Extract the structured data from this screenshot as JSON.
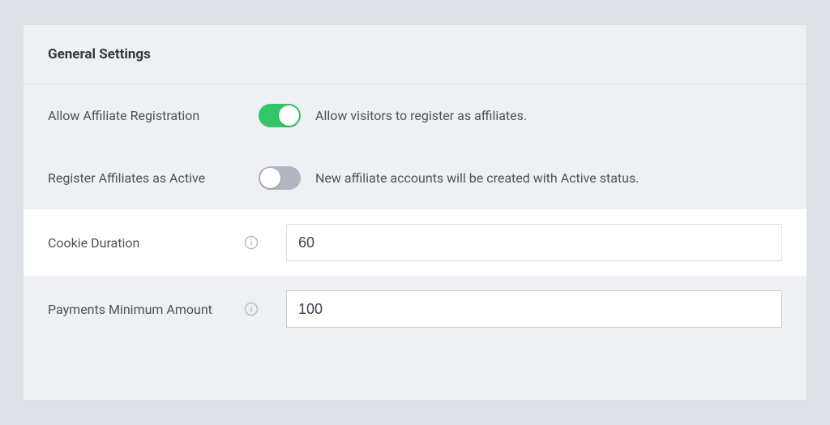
{
  "header": {
    "title": "General Settings"
  },
  "settings": {
    "allowRegistration": {
      "label": "Allow Affiliate Registration",
      "description": "Allow visitors to register as affiliates.",
      "enabled": true
    },
    "registerAsActive": {
      "label": "Register Affiliates as Active",
      "description": "New affiliate accounts will be created with Active status.",
      "enabled": false
    },
    "cookieDuration": {
      "label": "Cookie Duration",
      "value": "60"
    },
    "paymentsMinimum": {
      "label": "Payments Minimum Amount",
      "value": "100"
    }
  },
  "colors": {
    "toggleOn": "#33c666",
    "toggleOff": "#b0b7c0",
    "panelBg": "#eef0f3",
    "bodyBg": "#dee1e5"
  }
}
